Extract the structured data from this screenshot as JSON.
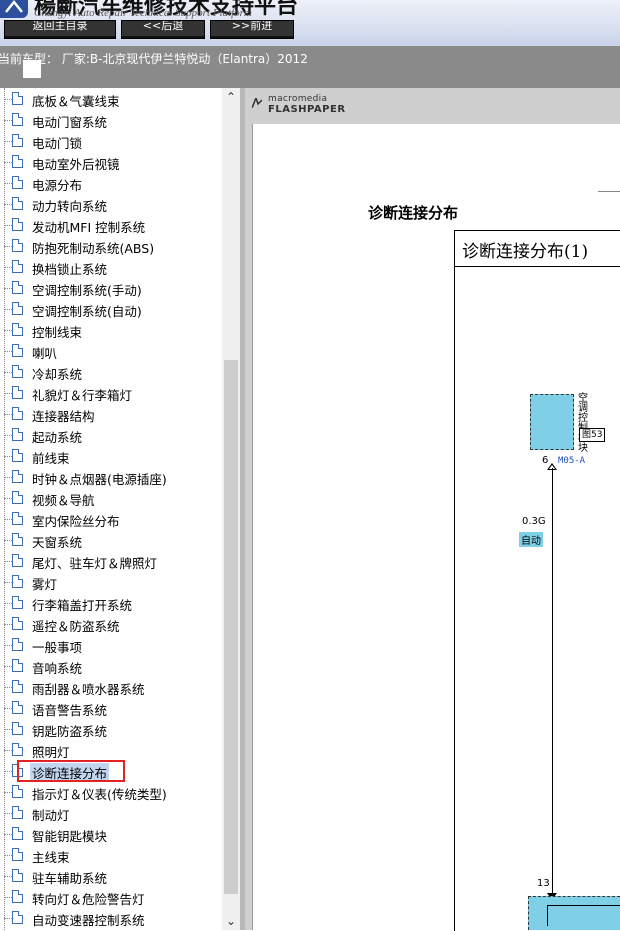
{
  "header": {
    "app_title": "楊斷汽车维修技术支持平台",
    "app_subtitle": "Changyi Auto Repair Technical Support Platform",
    "buttons": {
      "home": "返回主目录",
      "back": "<<后退",
      "forward": ">>前进"
    }
  },
  "vehicle_bar": {
    "text": "当前车型： 厂家:B-北京现代伊兰特悦动（Elantra）2012"
  },
  "tree": {
    "selected_index": 32,
    "items": [
      "底板＆气囊线束",
      "电动门窗系统",
      "电动门锁",
      "电动室外后视镜",
      "电源分布",
      "动力转向系统",
      "发动机MFI 控制系统",
      "防抱死制动系统(ABS)",
      "换档锁止系统",
      "空调控制系统(手动)",
      "空调控制系统(自动)",
      "控制线束",
      "喇叭",
      "冷却系统",
      "礼貌灯＆行李箱灯",
      "连接器结构",
      "起动系统",
      "前线束",
      "时钟＆点烟器(电源插座)",
      "视频＆导航",
      "室内保险丝分布",
      "天窗系统",
      "尾灯、驻车灯＆牌照灯",
      "雾灯",
      "行李箱盖打开系统",
      "遥控＆防盗系统",
      "一般事项",
      "音响系统",
      "雨刮器＆喷水器系统",
      "语音警告系统",
      "钥匙防盗系统",
      "照明灯",
      "诊断连接分布",
      "指示灯＆仪表(传统类型)",
      "制动灯",
      "智能钥匙模块",
      "主线束",
      "驻车辅助系统",
      "转向灯＆危险警告灯",
      "自动变速器控制系统"
    ]
  },
  "viewer": {
    "brand_top": "macromedia",
    "brand_bottom": "FLASHPAPER",
    "heading": "诊断连接分布",
    "box_title": "诊断连接分布(1)",
    "module_label": "空调控制模块",
    "fig_ref": "图53",
    "pin_top": "6",
    "connector_code": "M05-A",
    "wire_size": "0.3G",
    "wire_tag": "自动",
    "pin_bottom": "13"
  },
  "colors": {
    "module_fill": "#7fd0e6",
    "highlight_border": "#e02424",
    "connector_text": "#1f4fbf"
  }
}
